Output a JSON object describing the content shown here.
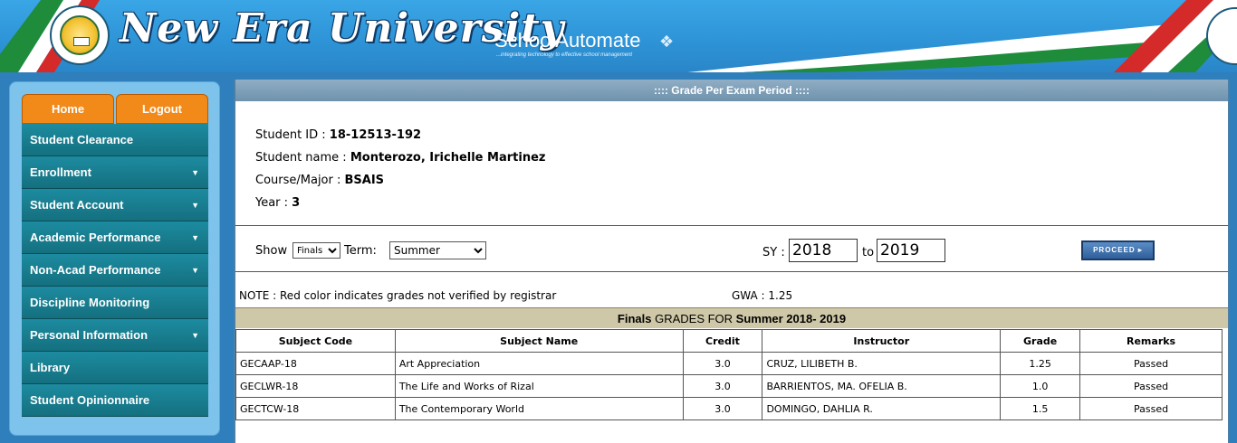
{
  "header": {
    "brand": "New Era University",
    "product": "SchoolAutomate",
    "tagline": "...integrating technology to effective school management",
    "logo_icon": "university-seal-icon",
    "colors": {
      "blue": "#2d93d6",
      "red": "#d42a2a",
      "green": "#1e8c3a"
    }
  },
  "sidebar": {
    "tabs": [
      {
        "label": "Home"
      },
      {
        "label": "Logout"
      }
    ],
    "items": [
      {
        "label": "Student Clearance",
        "arrow": ""
      },
      {
        "label": "Enrollment",
        "arrow": "▼"
      },
      {
        "label": "Student Account",
        "arrow": "▼"
      },
      {
        "label": "Academic Performance",
        "arrow": "▼"
      },
      {
        "label": "Non-Acad Performance",
        "arrow": "▼"
      },
      {
        "label": "Discipline Monitoring",
        "arrow": ""
      },
      {
        "label": "Personal Information",
        "arrow": "▼"
      },
      {
        "label": "Library",
        "arrow": ""
      },
      {
        "label": "Student Opinionnaire",
        "arrow": ""
      }
    ]
  },
  "main": {
    "title": ":::: Grade Per Exam Period ::::",
    "student": {
      "id_label": "Student ID : ",
      "id": "18-12513-192",
      "name_label": "Student name : ",
      "name": "Monterozo, Irichelle Martinez",
      "course_label": "Course/Major : ",
      "course": "BSAIS",
      "year_label": "Year : ",
      "year": "3"
    },
    "filters": {
      "show_label": "Show",
      "show_value": "Finals",
      "term_label": "Term:",
      "term_value": "Summer",
      "sy_label": "SY :",
      "sy_from": "2018",
      "to_label": "to",
      "sy_to": "2019",
      "proceed_label": "PROCEED ▸"
    },
    "note": "NOTE : Red color indicates grades not verified by registrar",
    "gwa": "GWA : 1.25",
    "grades_title": {
      "a": "Finals",
      "b": " GRADES FOR ",
      "c": "Summer 2018- 2019"
    },
    "table": {
      "headers": [
        "Subject Code",
        "Subject Name",
        "Credit",
        "Instructor",
        "Grade",
        "Remarks"
      ],
      "rows": [
        [
          "GECAAP-18",
          "Art Appreciation",
          "3.0",
          "CRUZ, LILIBETH B.",
          "1.25",
          "Passed"
        ],
        [
          "GECLWR-18",
          "The Life and Works of Rizal",
          "3.0",
          "BARRIENTOS, MA. OFELIA B.",
          "1.0",
          "Passed"
        ],
        [
          "GECTCW-18",
          "The Contemporary World",
          "3.0",
          "DOMINGO, DAHLIA R.",
          "1.5",
          "Passed"
        ]
      ]
    }
  }
}
